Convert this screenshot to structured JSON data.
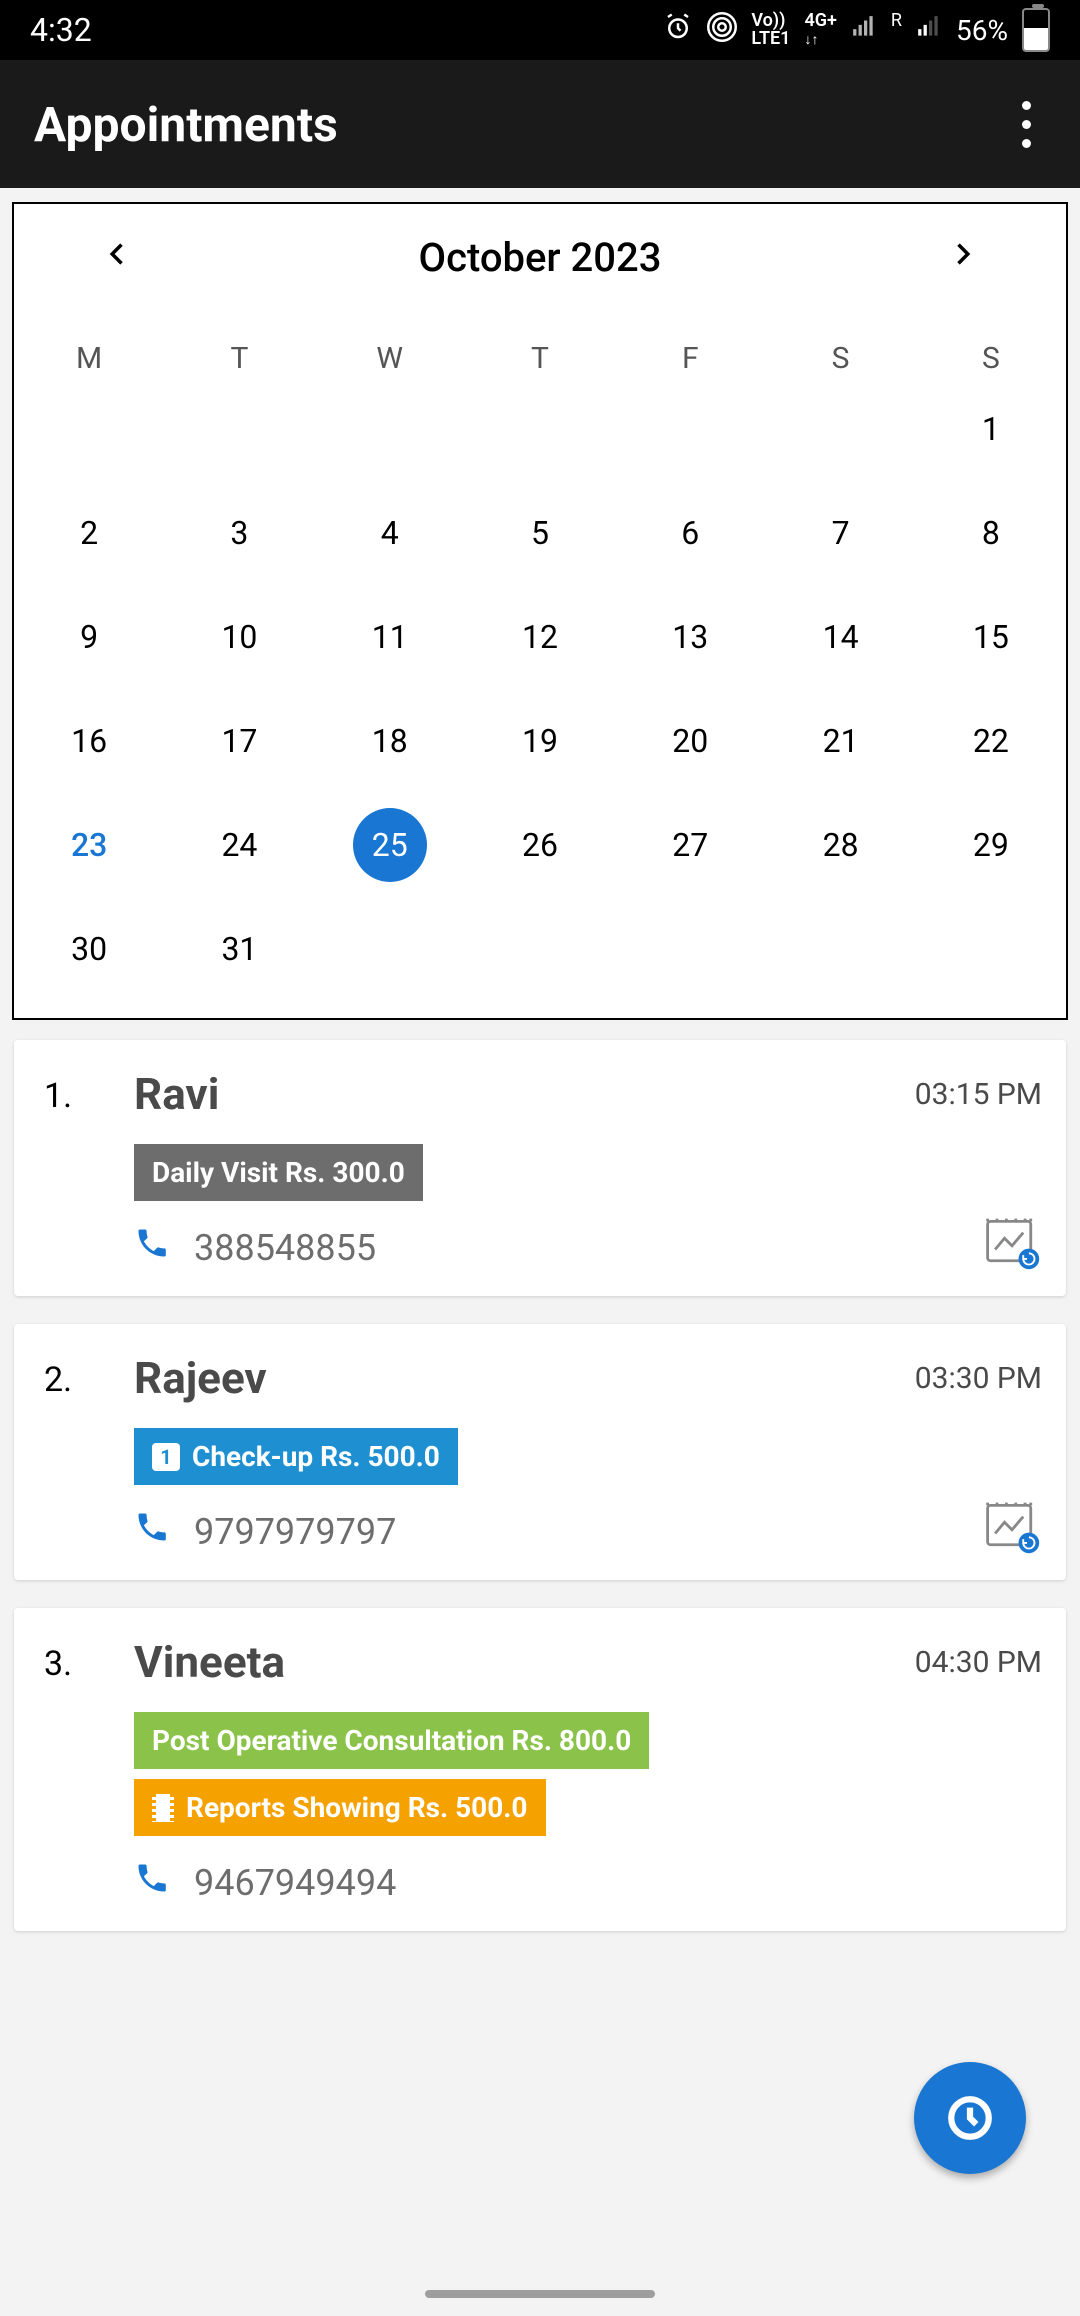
{
  "status": {
    "time": "4:32",
    "lte_top": "Vo))",
    "lte_bottom": "LTE1",
    "net": "4G+",
    "roam": "R",
    "battery_pct": "56%"
  },
  "header": {
    "title": "Appointments"
  },
  "calendar": {
    "month_label": "October 2023",
    "weekdays": [
      "M",
      "T",
      "W",
      "T",
      "F",
      "S",
      "S"
    ],
    "weeks": [
      [
        "",
        "",
        "",
        "",
        "",
        "",
        "1"
      ],
      [
        "2",
        "3",
        "4",
        "5",
        "6",
        "7",
        "8"
      ],
      [
        "9",
        "10",
        "11",
        "12",
        "13",
        "14",
        "15"
      ],
      [
        "16",
        "17",
        "18",
        "19",
        "20",
        "21",
        "22"
      ],
      [
        "23",
        "24",
        "25",
        "26",
        "27",
        "28",
        "29"
      ],
      [
        "30",
        "31",
        "",
        "",
        "",
        "",
        ""
      ]
    ],
    "today": "23",
    "selected": "25"
  },
  "appointments": [
    {
      "idx": "1.",
      "name": "Ravi",
      "time": "03:15 PM",
      "tags": [
        {
          "color": "gray",
          "badge": null,
          "text": "Daily Visit Rs. 300.0"
        }
      ],
      "phone": "388548855",
      "history": true
    },
    {
      "idx": "2.",
      "name": "Rajeev",
      "time": "03:30 PM",
      "tags": [
        {
          "color": "blue",
          "badge": "1",
          "text": "Check-up Rs. 500.0"
        }
      ],
      "phone": "9797979797",
      "history": true
    },
    {
      "idx": "3.",
      "name": "Vineeta",
      "time": "04:30 PM",
      "tags": [
        {
          "color": "green",
          "badge": null,
          "text": "Post Operative Consultation Rs. 800.0"
        },
        {
          "color": "orange",
          "badge": "film",
          "text": "Reports Showing Rs. 500.0"
        }
      ],
      "phone": "9467949494",
      "history": false
    }
  ]
}
